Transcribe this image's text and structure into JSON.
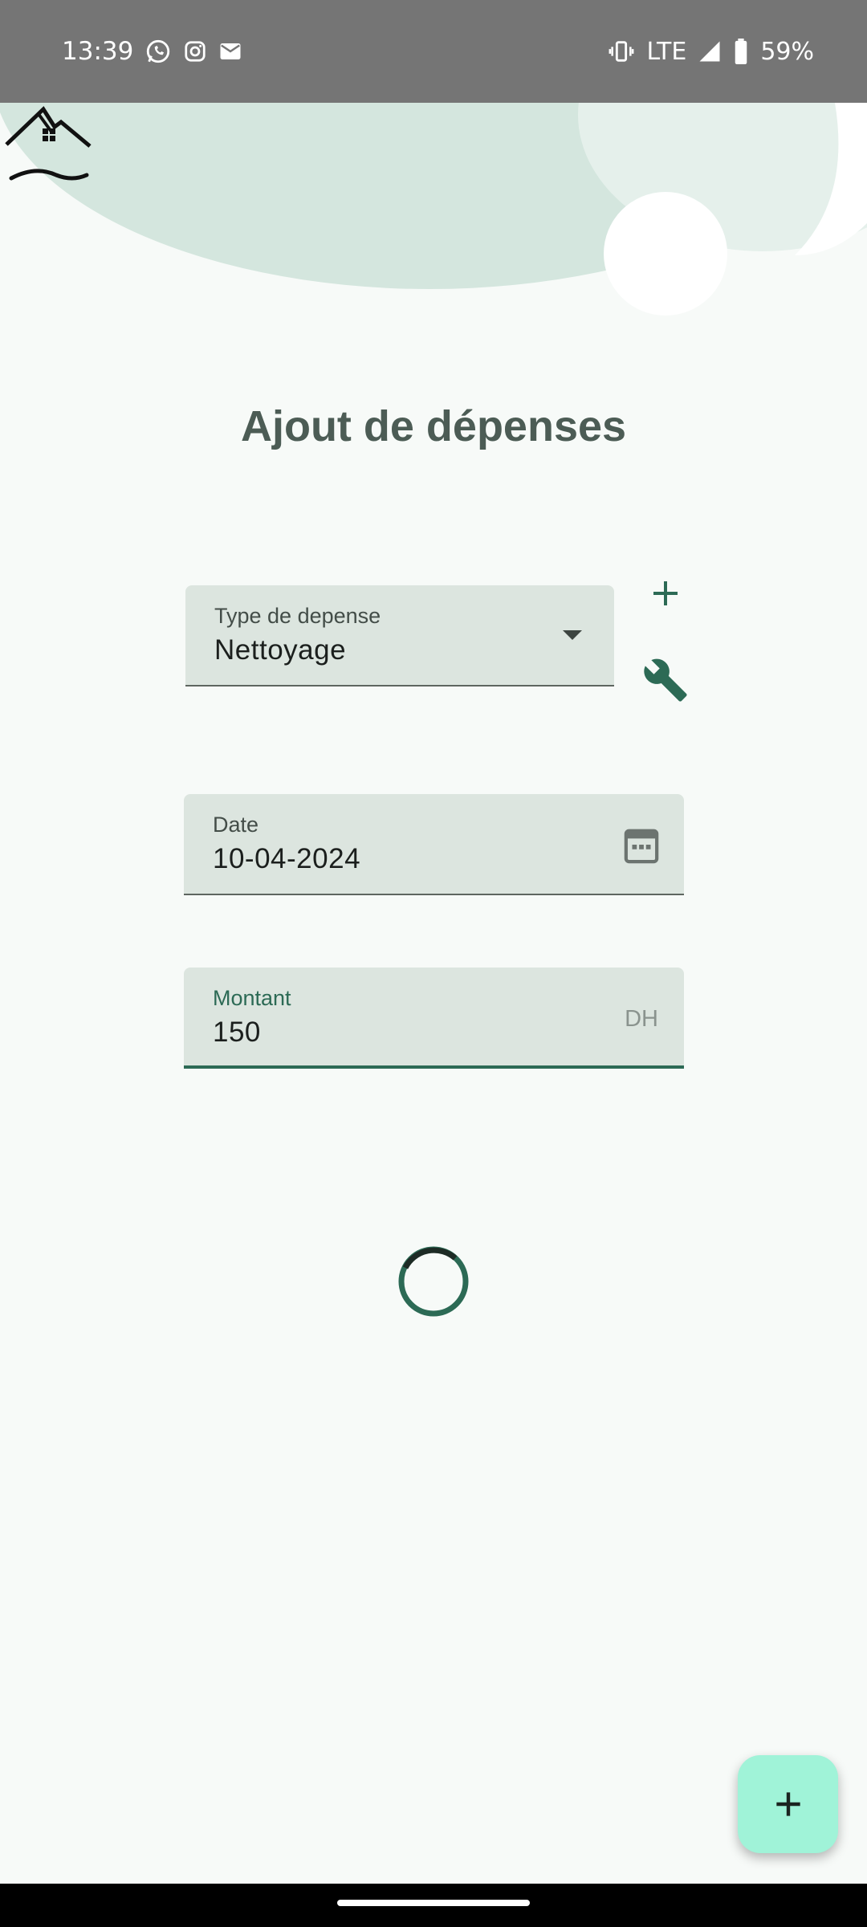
{
  "status_bar": {
    "time": "13:39",
    "network": "LTE",
    "battery": "59%",
    "icons": [
      "whatsapp-icon",
      "instagram-icon",
      "mail-icon",
      "vibrate-icon",
      "signal-icon",
      "battery-icon"
    ]
  },
  "page": {
    "title": "Ajout de dépenses"
  },
  "form": {
    "type": {
      "label": "Type de depense",
      "value": "Nettoyage"
    },
    "date": {
      "label": "Date",
      "value": "10-04-2024"
    },
    "amount": {
      "label": "Montant",
      "value": "150",
      "suffix": "DH"
    }
  },
  "colors": {
    "accent": "#2c6a55",
    "field_bg": "#dce5df",
    "fab_bg": "#a0f3d8",
    "header_blob": "#d4e6de",
    "background": "#f7faf8"
  }
}
